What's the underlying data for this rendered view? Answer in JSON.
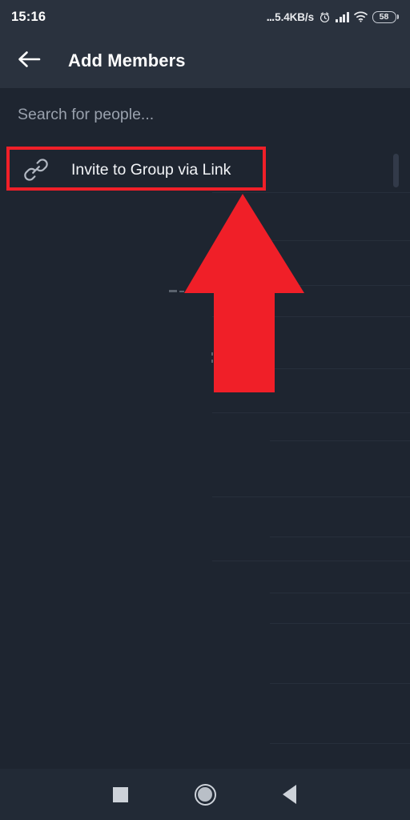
{
  "status_bar": {
    "time": "15:16",
    "network_dots": "...",
    "network_speed": "5.4KB/s",
    "alarm_icon": "alarm-clock-icon",
    "signal_icon": "cellular-signal-icon",
    "wifi_icon": "wifi-icon",
    "battery_level": "58"
  },
  "app_bar": {
    "back_icon": "back-arrow-icon",
    "title": "Add Members"
  },
  "search": {
    "placeholder": "Search for people...",
    "value": ""
  },
  "invite_row": {
    "icon": "link-chain-icon",
    "label": "Invite to Group via Link"
  },
  "annotation": {
    "highlight_color": "#f01f28",
    "arrow_color": "#f01f28",
    "arrow_icon": "up-arrow-annotation",
    "target": "Invite to Group via Link"
  },
  "list": {
    "divider_tops": [
      64,
      124,
      180,
      219,
      284,
      339,
      374,
      444,
      494,
      524,
      564,
      602,
      677,
      752
    ],
    "divider_lefts": [
      265,
      337,
      337,
      265,
      337,
      265,
      337,
      265,
      337,
      265,
      337,
      337,
      337,
      337
    ]
  },
  "scrollbar": {
    "thumb": "vertical-scroll-thumb"
  },
  "nav_bar": {
    "recents_icon": "recents-square-icon",
    "home_icon": "home-circle-icon",
    "back_icon": "back-triangle-icon"
  },
  "colors": {
    "app_bar_bg": "#2a323e",
    "body_bg": "#1e2530",
    "nav_bg": "#222a36",
    "accent_red": "#f01f28",
    "text_primary": "#f2f4f7",
    "text_placeholder": "#99a1ad"
  }
}
